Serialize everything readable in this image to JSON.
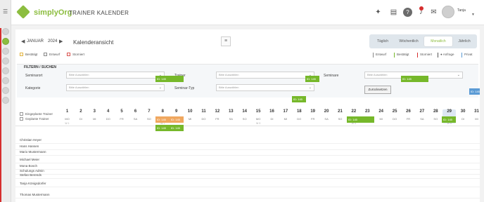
{
  "header": {
    "app_name": "simplyOrg",
    "title": "TRAINER KALENDER",
    "user_name": "Tanja",
    "icons": [
      "bulb-icon",
      "book-icon",
      "help-icon",
      "bell-icon",
      "mail-icon"
    ]
  },
  "sidebar": {
    "icons": [
      "menu-icon",
      "nav-icon-1",
      "nav-icon-2",
      "nav-icon-3",
      "nav-icon-4",
      "nav-icon-5",
      "nav-icon-6",
      "nav-icon-7",
      "nav-icon-8"
    ]
  },
  "toolbar": {
    "prev": "◀",
    "next": "▶",
    "month": "JANUAR",
    "year": "2024",
    "view_title": "Kalenderansicht",
    "menu_icon": "≡",
    "tabs": [
      {
        "label": "Täglich",
        "active": false
      },
      {
        "label": "Wöchentlich",
        "active": false
      },
      {
        "label": "Monatlich",
        "active": true
      },
      {
        "label": "Jährlich",
        "active": false
      }
    ]
  },
  "status_filters": [
    "Bestätigt",
    "Entwurf",
    "Storniert"
  ],
  "legend": [
    {
      "label": "Entwurf",
      "color": "#888888"
    },
    {
      "label": "Bestätigt",
      "color": "#76b82a"
    },
    {
      "label": "Storniert",
      "color": "#d62e2e"
    },
    {
      "label": "Anfrage",
      "color": "#555555",
      "prefix": "●"
    },
    {
      "label": "Privat",
      "color": "#5b9bd5"
    }
  ],
  "filter": {
    "title": "FILTERN / SUCHEN",
    "placeholder": "Bitte Auswählen",
    "fields": [
      "Seminarort",
      "Trainer",
      "Seminare",
      "Kategorie",
      "Seminar-Typ"
    ],
    "reset_label": "Zurücksetzen"
  },
  "grid": {
    "toggles": [
      "Eingeplante Trainer",
      "Geplante Trainer"
    ],
    "days": [
      "1",
      "2",
      "3",
      "4",
      "5",
      "6",
      "7",
      "8",
      "9",
      "10",
      "11",
      "12",
      "13",
      "14",
      "15",
      "16",
      "17",
      "18",
      "19",
      "20",
      "21",
      "22",
      "23",
      "24",
      "25",
      "26",
      "27",
      "28",
      "29",
      "30",
      "31"
    ],
    "weekdays": [
      "MO",
      "DI",
      "MI",
      "DO",
      "FR",
      "SA",
      "SO",
      "MO",
      "DI",
      "MI",
      "DO",
      "FR",
      "SA",
      "SO",
      "MO",
      "DI",
      "MI",
      "DO",
      "FR",
      "SA",
      "SO",
      "MO",
      "DI",
      "MI",
      "DO",
      "FR",
      "SA",
      "SO",
      "MO",
      "DI",
      "MI"
    ],
    "kw": {
      "1": "W 1",
      "8": "W 2",
      "15": "W 3",
      "22": "W 4",
      "29": "W 5"
    },
    "trainers": [
      "Christian Heyer",
      "Hans Hansen",
      "Mario Mustermann",
      "Michael Meier",
      "Mona Bosch",
      "Schulungs Admin",
      "Stefan Berends",
      "Tanja Königsdorfer",
      "Thomas Mustermann"
    ],
    "event_label": "ID: 145"
  }
}
